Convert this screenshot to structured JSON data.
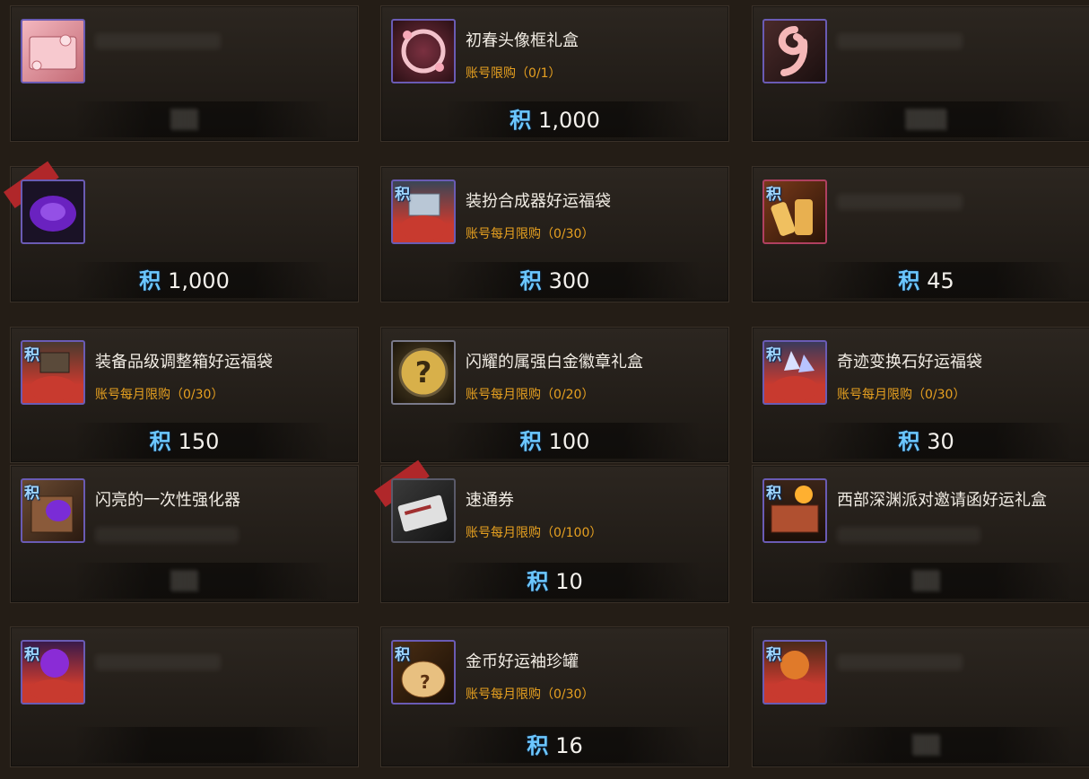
{
  "currency_symbol": "积",
  "items": [
    {
      "name": "",
      "limit": "",
      "price": "",
      "ji_tag": false,
      "ribbon": false,
      "icon": "pink-envelope-icon",
      "colors": [
        "#e9a0a8",
        "#b8505c"
      ]
    },
    {
      "name": "初春头像框礼盒",
      "limit": "账号限购（0/1）",
      "price": "1,000",
      "ji_tag": false,
      "ribbon": false,
      "icon": "flower-ring-icon",
      "colors": [
        "#f0b5c0",
        "#6a2d3a"
      ]
    },
    {
      "name": "",
      "limit": "",
      "price": "",
      "ji_tag": false,
      "ribbon": false,
      "icon": "pink-nine-icon",
      "colors": [
        "#f5b8b8",
        "#7b3b3b"
      ]
    },
    {
      "name": "",
      "limit": "",
      "price": "1,000",
      "ji_tag": false,
      "ribbon": true,
      "icon": "purple-orb-icon",
      "colors": [
        "#7a2cd6",
        "#1e0f34"
      ]
    },
    {
      "name": "装扮合成器好运福袋",
      "limit": "账号每月限购（0/30）",
      "price": "300",
      "ji_tag": true,
      "ribbon": false,
      "icon": "synth-bag-icon",
      "colors": [
        "#b9c7d6",
        "#c83a2f"
      ]
    },
    {
      "name": "",
      "limit": "",
      "price": "45",
      "ji_tag": true,
      "ribbon": false,
      "icon": "gold-scroll-icon",
      "colors": [
        "#f0c060",
        "#6a3a1a"
      ]
    },
    {
      "name": "装备品级调整箱好运福袋",
      "limit": "账号每月限购（0/30）",
      "price": "150",
      "ji_tag": true,
      "ribbon": false,
      "icon": "grade-box-bag-icon",
      "colors": [
        "#7a6a5a",
        "#c83a2f"
      ]
    },
    {
      "name": "闪耀的属强白金徽章礼盒",
      "limit": "账号每月限购（0/20）",
      "price": "100",
      "ji_tag": false,
      "ribbon": false,
      "icon": "question-badge-icon",
      "colors": [
        "#d8b04a",
        "#5a4a2a"
      ]
    },
    {
      "name": "奇迹变换石好运福袋",
      "limit": "账号每月限购（0/30）",
      "price": "30",
      "ji_tag": true,
      "ribbon": false,
      "icon": "crystal-bag-icon",
      "colors": [
        "#cfd8ff",
        "#c83a2f"
      ]
    },
    {
      "name": "闪亮的一次性强化器",
      "limit": "",
      "price": "",
      "ji_tag": true,
      "ribbon": false,
      "icon": "enhancer-icon",
      "colors": [
        "#8a5a3a",
        "#7a2cd6"
      ]
    },
    {
      "name": "速通券",
      "limit": "账号每月限购（0/100）",
      "price": "10",
      "ji_tag": false,
      "ribbon": true,
      "icon": "ticket-icon",
      "colors": [
        "#d8d8d8",
        "#2a2a2a"
      ]
    },
    {
      "name": "西部深渊派对邀请函好运礼盒",
      "limit": "",
      "price": "",
      "ji_tag": true,
      "ribbon": false,
      "icon": "treasure-chest-icon",
      "colors": [
        "#b05030",
        "#ffb030"
      ]
    },
    {
      "name": "",
      "limit": "",
      "price": "",
      "ji_tag": true,
      "ribbon": false,
      "icon": "purple-bag-icon",
      "colors": [
        "#8a2cd6",
        "#c83a2f"
      ]
    },
    {
      "name": "金币好运袖珍罐",
      "limit": "账号每月限购（0/30）",
      "price": "16",
      "ji_tag": true,
      "ribbon": false,
      "icon": "gold-jar-icon",
      "colors": [
        "#e8c080",
        "#6a4020"
      ]
    },
    {
      "name": "",
      "limit": "",
      "price": "",
      "ji_tag": true,
      "ribbon": false,
      "icon": "amber-bag-icon",
      "colors": [
        "#e07a2a",
        "#c83a2f"
      ]
    }
  ]
}
